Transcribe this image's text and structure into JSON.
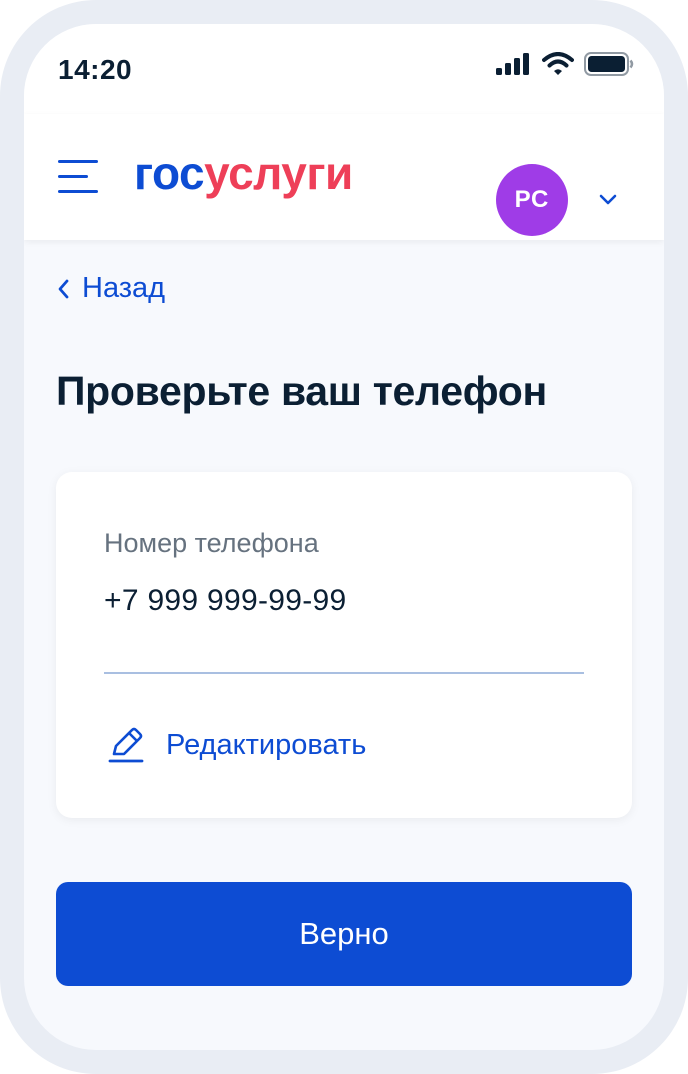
{
  "status_bar": {
    "time": "14:20",
    "icons": [
      "cellular-signal-icon",
      "wifi-icon",
      "battery-icon"
    ]
  },
  "header": {
    "logo": {
      "part1": "гос",
      "part2": "услуги"
    },
    "avatar_initials": "РС",
    "menu_icon": "hamburger-menu-icon",
    "dropdown_icon": "chevron-down-icon"
  },
  "nav": {
    "back_label": "Назад",
    "back_icon": "chevron-left-icon"
  },
  "page": {
    "title": "Проверьте ваш телефон"
  },
  "phone_card": {
    "label": "Номер телефона",
    "value": "+7 999 999-99-99",
    "edit_label": "Редактировать",
    "edit_icon": "pencil-icon"
  },
  "actions": {
    "confirm_label": "Верно"
  },
  "colors": {
    "accent": "#0d4cd3",
    "logo_red": "#ee3f58",
    "avatar": "#9f3ce7",
    "text_primary": "#0b1f33",
    "text_secondary": "#66727f",
    "background": "#f7f9fd"
  }
}
